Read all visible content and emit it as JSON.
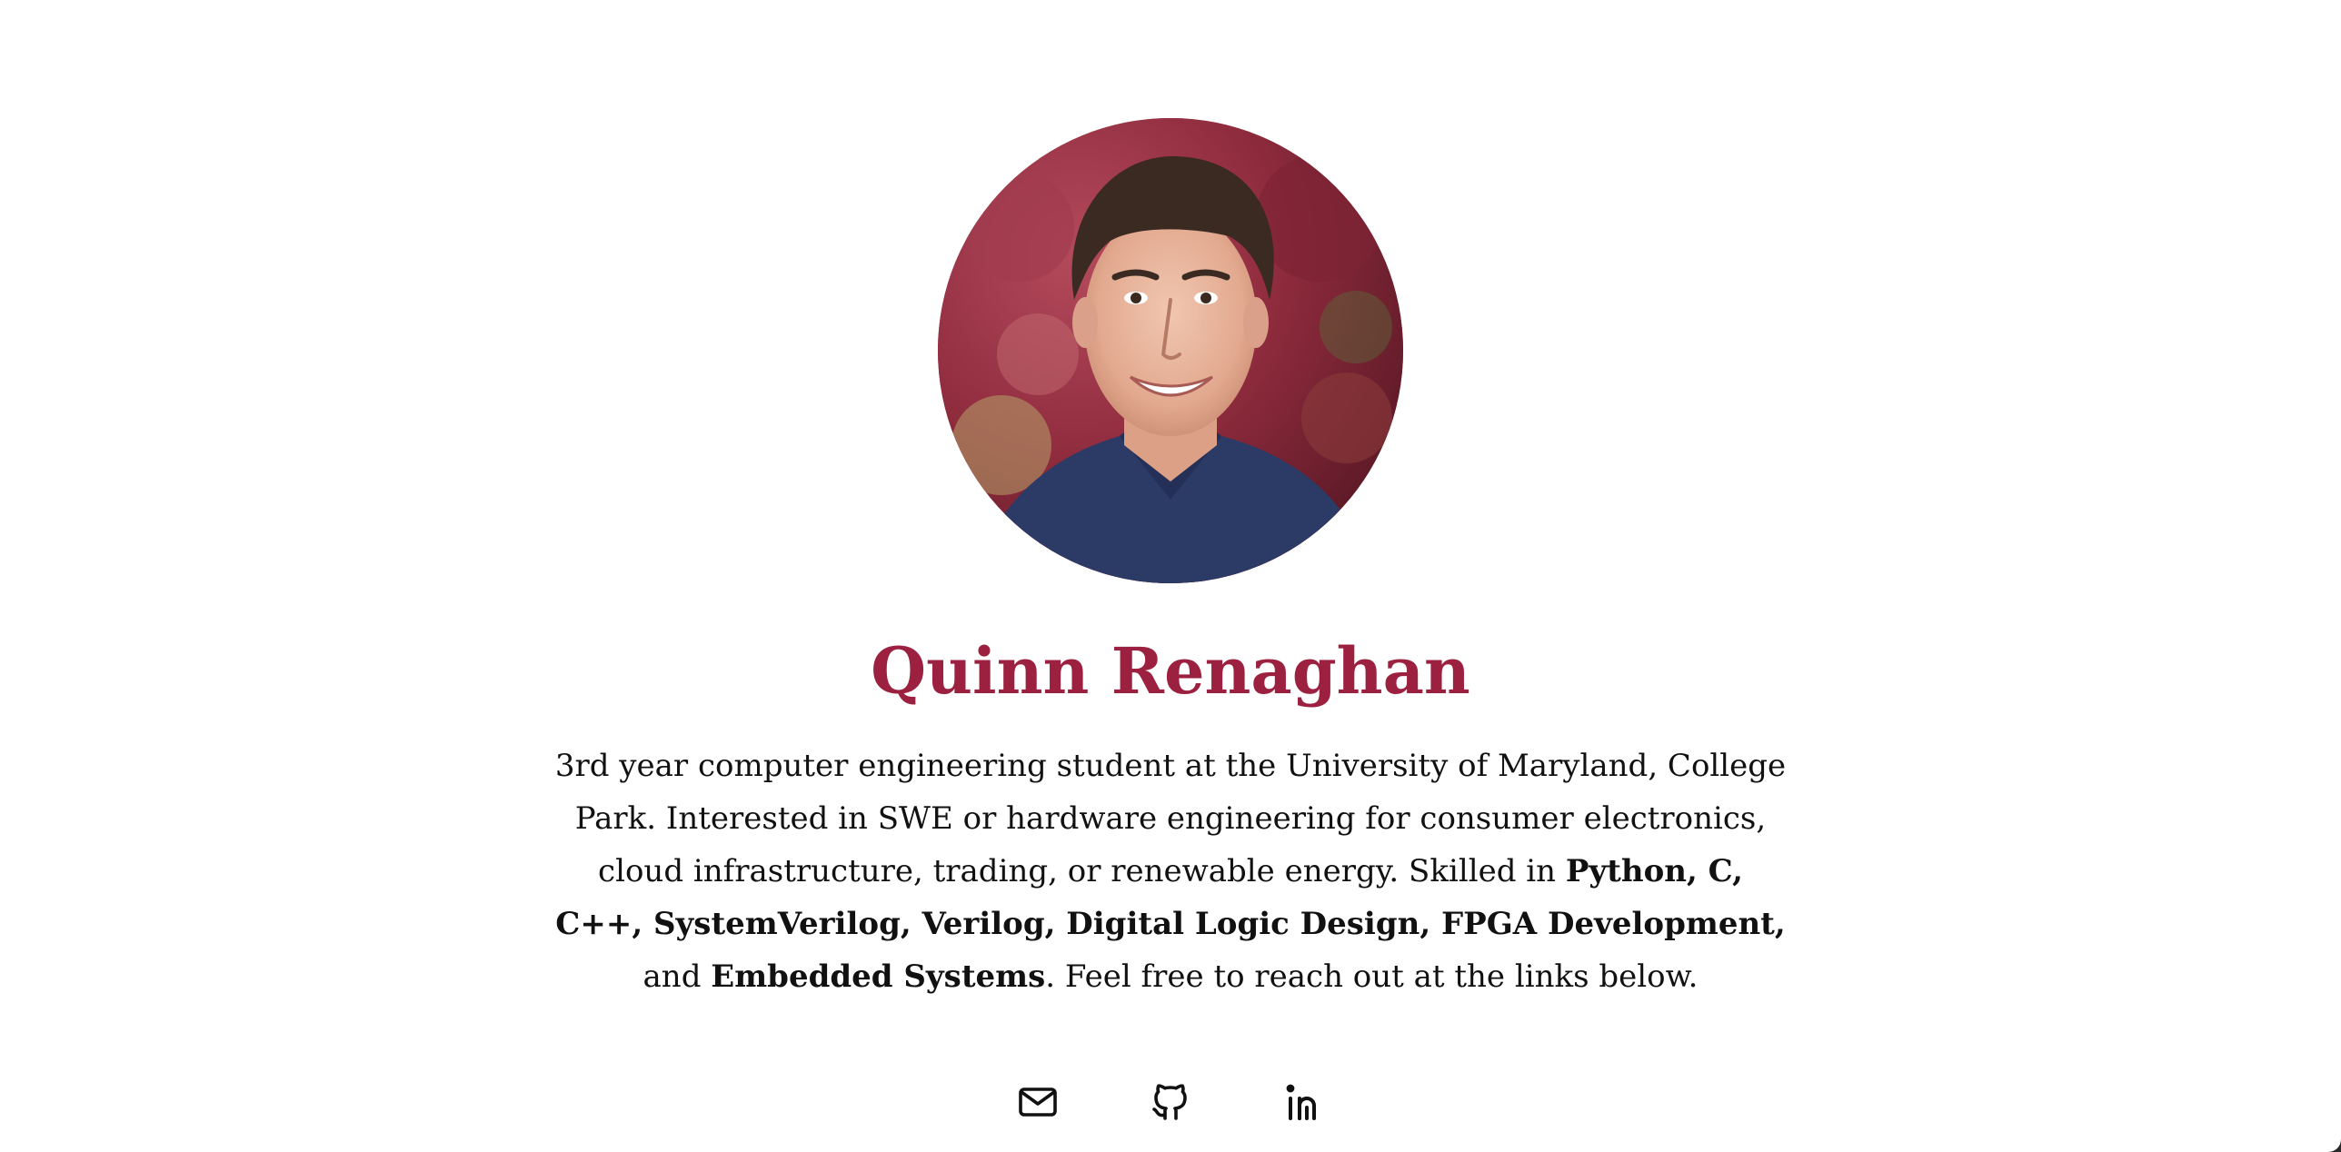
{
  "profile": {
    "name": "Quinn Renaghan",
    "avatar_alt": "Photo of Quinn Renaghan",
    "bio": {
      "intro": "3rd year computer engineering student at the University of Maryland, College Park. Interested in SWE or hardware engineering for consumer electronics, cloud infrastructure, trading, or renewable energy. Skilled in ",
      "skills": "Python, C, C++, SystemVerilog, Verilog, Digital Logic Design, FPGA Development,",
      "and_word": " and ",
      "last_skill": "Embedded Systems",
      "outro": ". Feel free to reach out at the links below."
    }
  },
  "links": [
    {
      "icon": "mail-icon",
      "label": "Email"
    },
    {
      "icon": "github-icon",
      "label": "GitHub"
    },
    {
      "icon": "linkedin-icon",
      "label": "LinkedIn"
    }
  ],
  "colors": {
    "accent": "#9c2140",
    "text": "#111111",
    "background": "#ffffff"
  }
}
